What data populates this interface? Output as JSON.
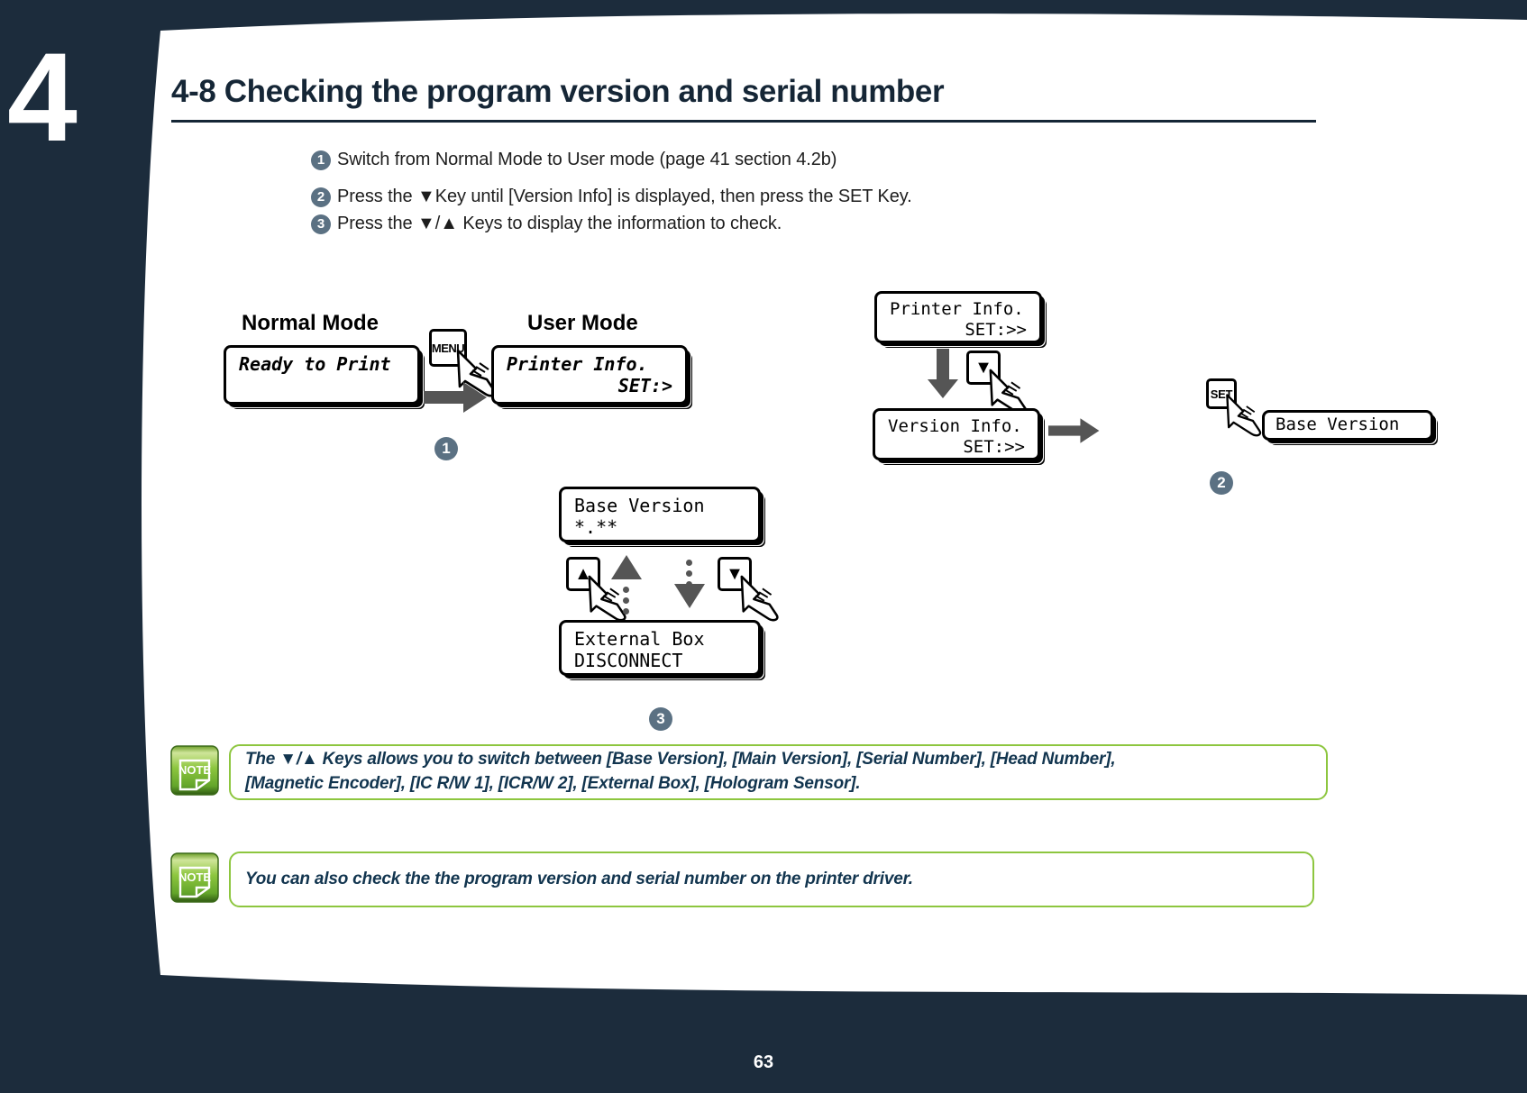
{
  "chapter": {
    "number": "4"
  },
  "header": {
    "title": "4-8 Checking the program version and serial number"
  },
  "steps": [
    {
      "num": "1",
      "text": "Switch from Normal Mode to User mode (page 41 section 4.2b)"
    },
    {
      "num": "2",
      "text": "Press the ▼Key until [Version Info] is displayed, then press the SET Key."
    },
    {
      "num": "3",
      "text": "Press the ▼/▲ Keys to display the information to check."
    }
  ],
  "diagram1": {
    "normal_mode_label": "Normal Mode",
    "user_mode_label": "User Mode",
    "normal_lcd_line1": "Ready to Print",
    "user_lcd_line1": "Printer Info.",
    "user_lcd_line2": "SET:>",
    "menu_key_label": "MENU",
    "marker": "1"
  },
  "diagram2": {
    "lcd_a_line1": "Printer Info.",
    "lcd_a_line2": "SET:>>",
    "lcd_b_line1": "Version Info.",
    "lcd_b_line2": "SET:>>",
    "lcd_c_line1": "Base Version",
    "down_key_label": "▼",
    "set_key_label": "SET",
    "marker": "2"
  },
  "diagram3": {
    "lcd_top_line1": "Base Version",
    "lcd_top_line2": "*.**",
    "lcd_bottom_line1": "External Box",
    "lcd_bottom_line2": "DISCONNECT",
    "up_key_label": "▲",
    "down_key_label": "▼",
    "marker": "3"
  },
  "notes": [
    {
      "icon_label": "NOTE",
      "line1": "The ▼/▲ Keys allows you to switch between [Base Version], [Main Version], [Serial Number], [Head Number],",
      "line2": "[Magnetic Encoder], [IC R/W 1], [ICR/W 2], [External Box], [Hologram Sensor]."
    },
    {
      "icon_label": "NOTE",
      "line1": "You can also check the the program version and serial number on the printer driver.",
      "line2": ""
    }
  ],
  "footer": {
    "page_number": "63"
  },
  "colors": {
    "dark_navy": "#1c2c3c",
    "title_navy": "#152636",
    "marker_slate": "#5b7183",
    "note_green": "#8dc63f",
    "note_text_navy": "#12354f"
  }
}
